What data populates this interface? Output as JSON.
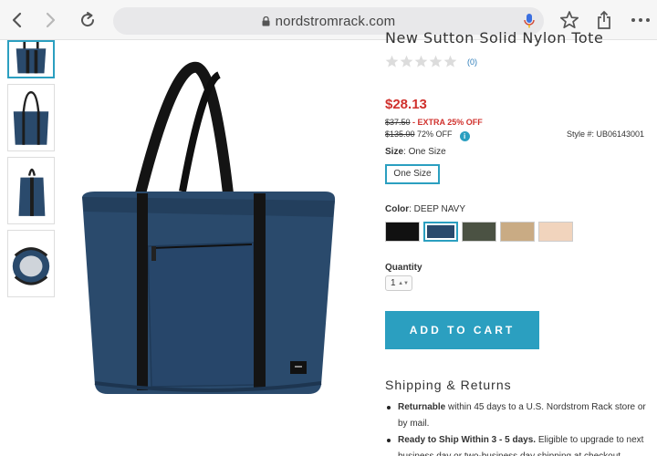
{
  "browser": {
    "url": "nordstromrack.com",
    "icons": [
      "back-icon",
      "forward-icon",
      "reload-icon",
      "lock-icon",
      "microphone-icon",
      "bookmark-star-icon",
      "share-icon",
      "more-icon"
    ]
  },
  "product": {
    "title": "New Sutton Solid Nylon Tote",
    "rating": 0,
    "review_count": "(0)",
    "price": "$28.13",
    "was_price": "$37.50",
    "extra_discount": " - EXTRA 25% OFF",
    "original_price": "$135.00",
    "original_discount": " 72% OFF",
    "info_icon": "i",
    "style_number": "Style #: UB06143001",
    "size_label": "Size",
    "size_value": "One Size",
    "size_button": "One Size",
    "color_label": "Color",
    "color_value": "DEEP NAVY",
    "swatches": [
      {
        "color": "#111111",
        "selected": false
      },
      {
        "color": "#2a4a6c",
        "selected": true
      },
      {
        "color": "#4b5243",
        "selected": false
      },
      {
        "color": "#c9ab84",
        "selected": false
      },
      {
        "color": "#f1d4bd",
        "selected": false
      }
    ],
    "quantity_label": "Quantity",
    "quantity_value": "1",
    "quantity_caret": "▲▼",
    "add_to_cart": "ADD TO CART"
  },
  "shipping": {
    "title": "Shipping & Returns",
    "items": [
      {
        "bold": "Returnable",
        "text": " within 45 days to a U.S. Nordstrom Rack store or by mail."
      },
      {
        "bold": "Ready to Ship Within 3 - 5 days.",
        "text": " Eligible to upgrade to next business day or two-business day shipping at checkout."
      }
    ]
  },
  "colors": {
    "accent": "#2b9fc0",
    "price_red": "#d0312d",
    "bag_navy": "#2a4a6c"
  }
}
